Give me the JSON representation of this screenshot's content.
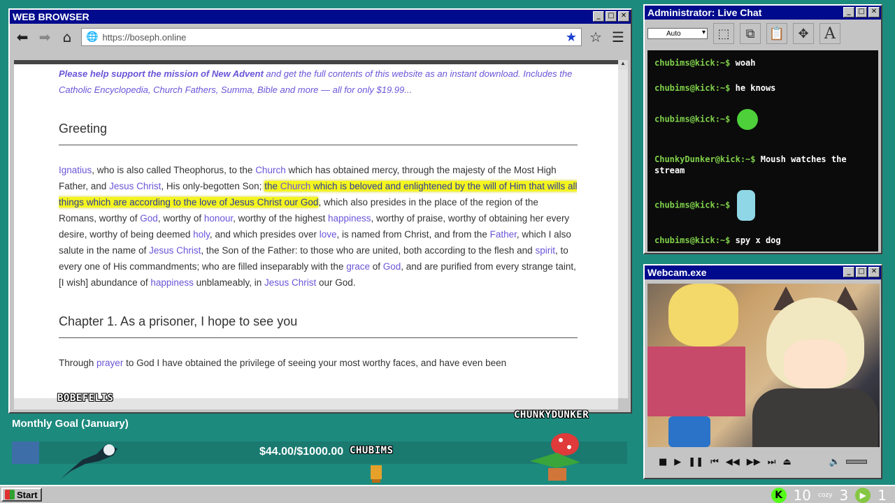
{
  "browser": {
    "title": "WEB BROWSER",
    "url": "https://boseph.online",
    "promo_bold": "Please help support the mission of New Advent",
    "promo_rest": " and get the full contents of this website as an instant download. Includes the Catholic Encyclopedia, Church Fathers, Summa, Bible and more — all for only $19.99...",
    "heading1": "Greeting",
    "greeting": {
      "s1": "Ignatius",
      "s2": ", who is also called Theophorus, to the ",
      "s3": "Church",
      "s4": " which has obtained mercy, through the majesty of the Most High Father, and ",
      "s5": "Jesus Christ",
      "s6": ", His only-begotten Son; ",
      "h1": "the ",
      "h2": "Church",
      "h3": " which is beloved and enlightened by the will of Him that wills all things which are according to the love of Jesus Christ our God",
      "s7": ", which also presides in the place of the region of the Romans, worthy of ",
      "s8": "God",
      "s9": ", worthy of ",
      "s10": "honour",
      "s11": ", worthy of the highest ",
      "s12": "happiness",
      "s13": ", worthy of praise, worthy of obtaining her every desire, worthy of being deemed ",
      "s14": "holy",
      "s15": ", and which presides over ",
      "s16": "love",
      "s17": ", is named from Christ, and from the ",
      "s18": "Father",
      "s19": ", which I also salute in the name of ",
      "s20": "Jesus Christ",
      "s21": ", the Son of the Father: to those who are united, both according to the flesh and ",
      "s22": "spirit",
      "s23": ", to every one of His commandments; who are filled inseparably with the ",
      "s24": "grace",
      "s25": " of ",
      "s26": "God",
      "s27": ", and are purified from every strange taint, [I wish] abundance of ",
      "s28": "happiness",
      "s29": " unblameably, in ",
      "s30": "Jesus Christ",
      "s31": " our God."
    },
    "heading2": "Chapter 1. As a prisoner, I hope to see you",
    "ch1": {
      "a": "Through ",
      "b": "prayer",
      "c": " to God I have obtained the privilege of seeing your most worthy faces, and have even been"
    },
    "overlay_name": "BOBEFELIS"
  },
  "chat": {
    "title": "Administrator: Live Chat",
    "select_value": "Auto",
    "lines": [
      {
        "prompt": "chubims@kick:~$",
        "text": "woah"
      },
      {
        "prompt": "chubims@kick:~$",
        "text": "he knows"
      },
      {
        "prompt": "chubims@kick:~$",
        "text": ""
      },
      {
        "prompt": "ChunkyDunker@kick:~$",
        "text": "Moush watches the stream"
      },
      {
        "prompt": "chubims@kick:~$",
        "text": ""
      },
      {
        "prompt": "chubims@kick:~$",
        "text": "spy x dog"
      }
    ]
  },
  "webcam": {
    "title": "Webcam.exe"
  },
  "goal": {
    "title": "Monthly Goal (January)",
    "amount": "$44.00/$1000.00",
    "progress": 0.044,
    "names": [
      "CHUNKYDUNKER",
      "CHUBIMS"
    ]
  },
  "taskbar": {
    "start": "Start",
    "kick_count": "10",
    "cozy_label": "cozy",
    "count2": "3",
    "rumble_count": "1"
  }
}
